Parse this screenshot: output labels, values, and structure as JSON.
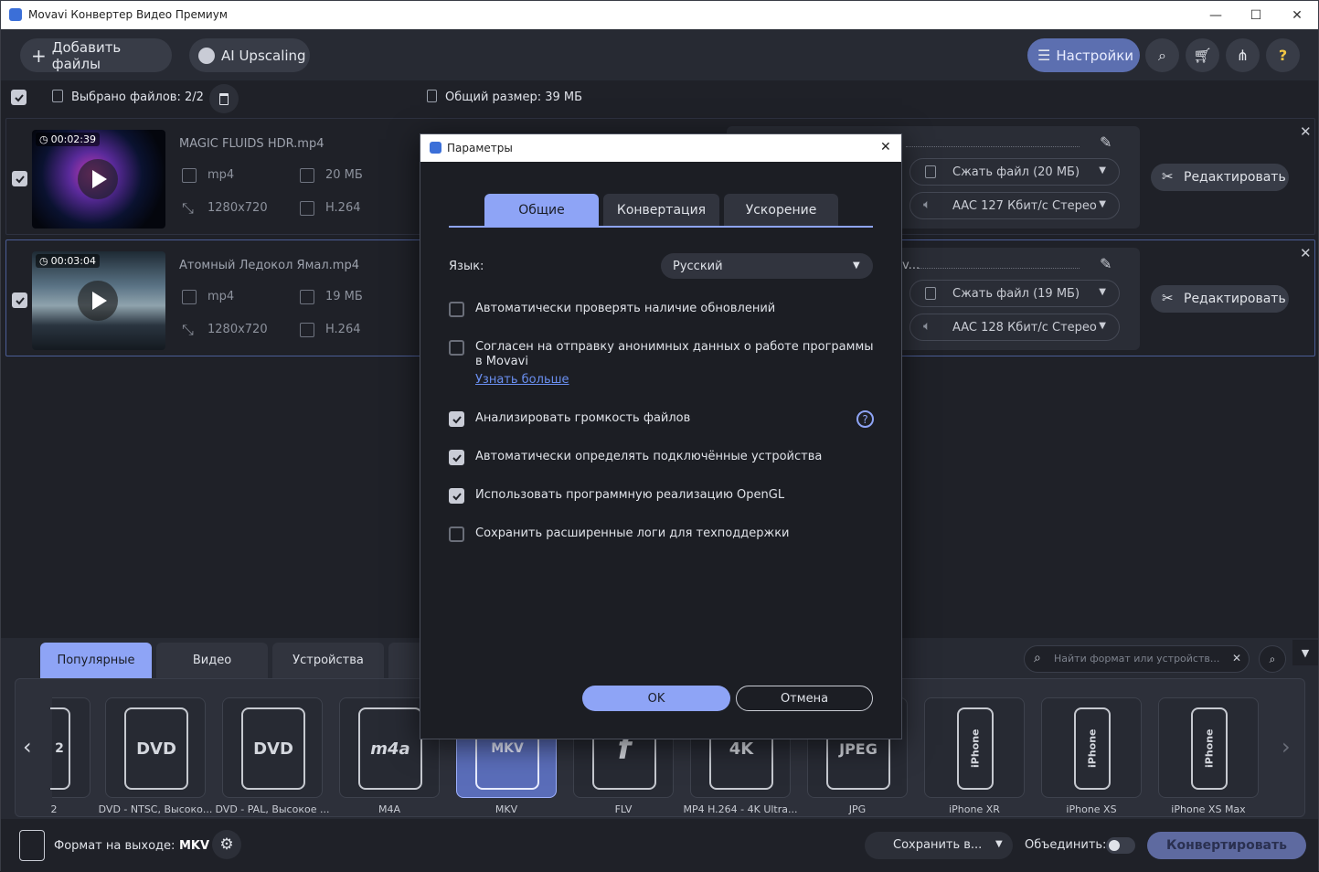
{
  "window": {
    "title": "Movavi Конвертер Видео Премиум",
    "min": "—",
    "max": "☐",
    "close": "✕"
  },
  "toolbar": {
    "add_files": "Добавить файлы",
    "ai_upscaling": "AI Upscaling",
    "settings": "Настройки"
  },
  "selection": {
    "selected": "Выбрано файлов: 2/2",
    "total_size": "Общий размер: 39 МБ"
  },
  "files": [
    {
      "duration": "00:02:39",
      "name": "MAGIC FLUIDS HDR.mp4",
      "container": "mp4",
      "size": "20 МБ",
      "resolution": "1280x720",
      "codec": "H.264",
      "compress": "Сжать файл (20 МБ)",
      "audio": "AAC 127 Кбит/с Стерео",
      "edit": "Редактировать",
      "out_name": ""
    },
    {
      "duration": "00:03:04",
      "name": "Атомный Ледокол Ямал.mp4",
      "container": "mp4",
      "size": "19 МБ",
      "resolution": "1280x720",
      "codec": "H.264",
      "compress": "Сжать файл (19 МБ)",
      "audio": "AAC 128 Кбит/с Стерео",
      "edit": "Редактировать",
      "out_name": "v..."
    }
  ],
  "format_tabs": [
    "Популярные",
    "Видео",
    "Устройства"
  ],
  "search": {
    "placeholder": "Найти формат или устройств..."
  },
  "formats": [
    {
      "label": "2",
      "logo": "2"
    },
    {
      "label": "DVD - NTSC, Высоко...",
      "logo": "DVD"
    },
    {
      "label": "DVD - PAL, Высокое ...",
      "logo": "DVD"
    },
    {
      "label": "M4A",
      "logo": "m4a"
    },
    {
      "label": "MKV",
      "logo": "MKV"
    },
    {
      "label": "FLV",
      "logo": "f"
    },
    {
      "label": "MP4 H.264 - 4K Ultra...",
      "logo": "4K"
    },
    {
      "label": "JPG",
      "logo": "JPEG"
    },
    {
      "label": "iPhone XR",
      "logo": "iPhone"
    },
    {
      "label": "iPhone XS",
      "logo": "iPhone"
    },
    {
      "label": "iPhone XS Max",
      "logo": "iPhone"
    }
  ],
  "footer": {
    "output_label": "Формат на выходе:",
    "output_value": "MKV",
    "save_to": "Сохранить в...",
    "merge": "Объединить:",
    "convert": "Конвертировать"
  },
  "dialog": {
    "title": "Параметры",
    "tabs": [
      "Общие",
      "Конвертация",
      "Ускорение"
    ],
    "language_label": "Язык:",
    "language_value": "Русский",
    "options": [
      {
        "text": "Автоматически проверять наличие обновлений",
        "checked": false
      },
      {
        "text": "Согласен на отправку анонимных данных о работе программы в Movavi",
        "checked": false
      },
      {
        "text": "Анализировать громкость файлов",
        "checked": true
      },
      {
        "text": "Автоматически определять подключённые устройства",
        "checked": true
      },
      {
        "text": "Использовать программную реализацию OpenGL",
        "checked": true
      },
      {
        "text": "Сохранить расширенные логи для техподдержки",
        "checked": false
      }
    ],
    "learn_more": "Узнать больше",
    "ok": "OK",
    "cancel": "Отмена"
  },
  "colors": {
    "accent": "#8ea4f6",
    "bg": "#1f2128",
    "panel": "#272a33"
  }
}
